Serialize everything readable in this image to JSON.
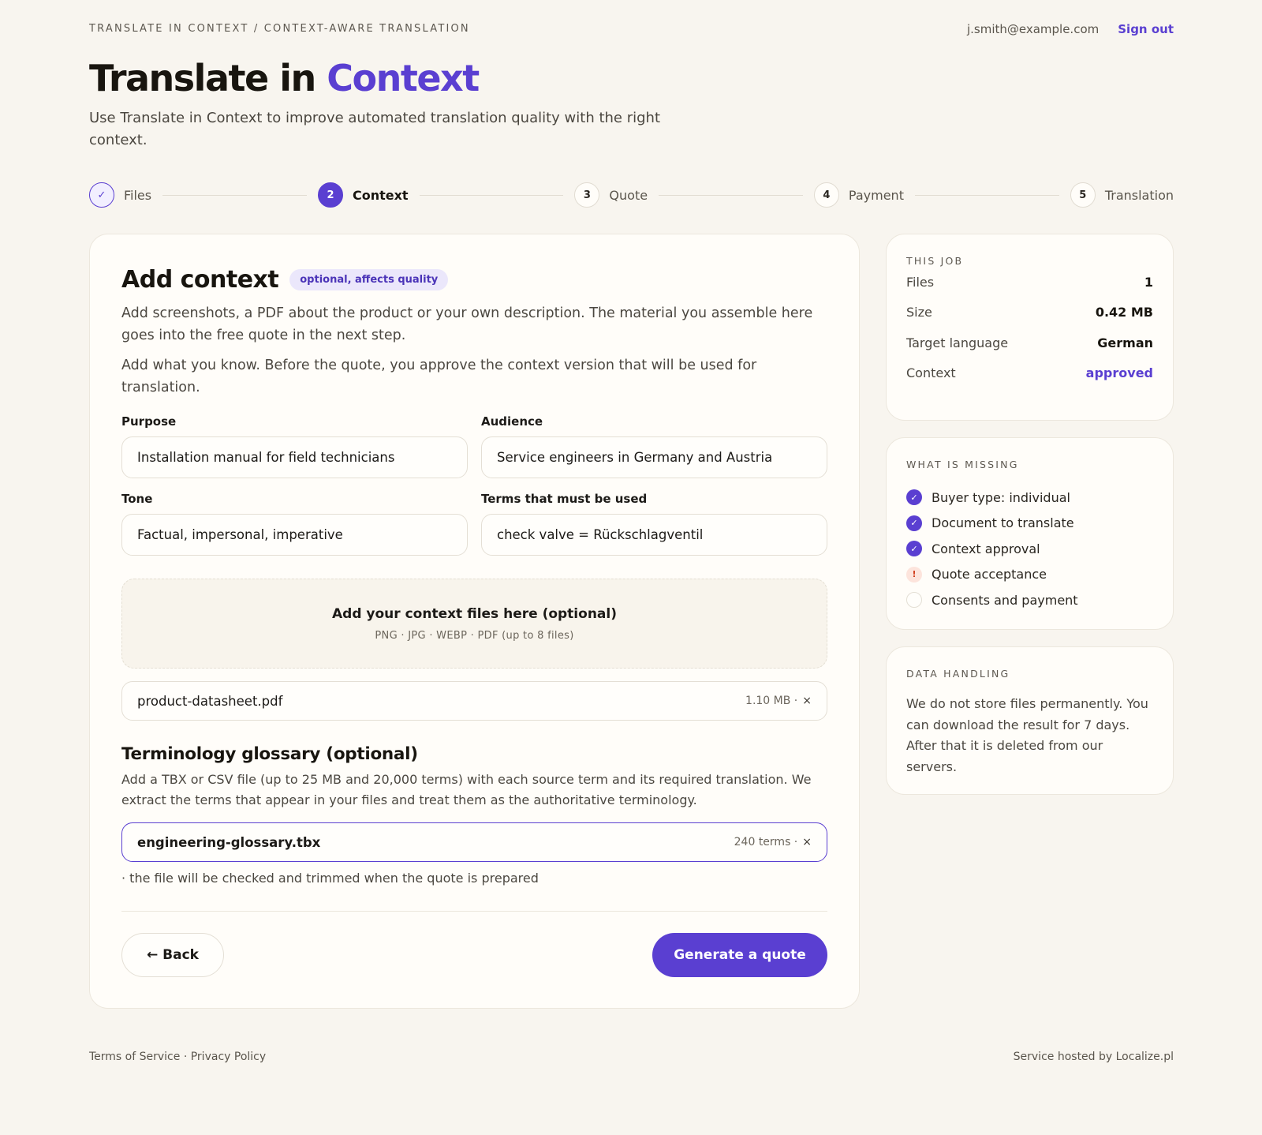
{
  "header": {
    "breadcrumb": "TRANSLATE IN CONTEXT / CONTEXT-AWARE TRANSLATION",
    "user_email": "j.smith@example.com",
    "sign_out": "Sign out",
    "title_main": "Translate in ",
    "title_accent": "Context",
    "subtitle": "Use Translate in Context to improve automated translation quality with the right context."
  },
  "stepper": {
    "steps": [
      {
        "number": "✓",
        "label": "Files",
        "state": "done"
      },
      {
        "number": "2",
        "label": "Context",
        "state": "active"
      },
      {
        "number": "3",
        "label": "Quote",
        "state": "pending"
      },
      {
        "number": "4",
        "label": "Payment",
        "state": "pending"
      },
      {
        "number": "5",
        "label": "Translation",
        "state": "pending"
      }
    ]
  },
  "context": {
    "heading": "Add context",
    "badge": "optional, affects quality",
    "desc1": "Add screenshots, a PDF about the product or your own description. The material you assemble here goes into the free quote in the next step.",
    "desc2": "Add what you know. Before the quote, you approve the context version that will be used for translation.",
    "fields": {
      "purpose": {
        "label": "Purpose",
        "value": "Installation manual for field technicians"
      },
      "audience": {
        "label": "Audience",
        "value": "Service engineers in Germany and Austria"
      },
      "tone": {
        "label": "Tone",
        "value": "Factual, impersonal, imperative"
      },
      "terms": {
        "label": "Terms that must be used",
        "value": "check valve = Rückschlagventil"
      }
    },
    "dropzone": {
      "title": "Add your context files here (optional)",
      "formats": "PNG · JPG · WEBP · PDF (up to 8 files)"
    },
    "uploaded_file": {
      "name": "product-datasheet.pdf",
      "meta": "1.10 MB ·",
      "remove": "×"
    }
  },
  "glossary": {
    "heading": "Terminology glossary (optional)",
    "desc": "Add a TBX or CSV file (up to 25 MB and 20,000 terms) with each source term and its required translation. We extract the terms that appear in your files and treat them as the authoritative terminology.",
    "file": {
      "name": "engineering-glossary.tbx",
      "meta": "240 terms ·",
      "remove": "×"
    },
    "note": "· the file will be checked and trimmed when the quote is prepared"
  },
  "actions": {
    "back": "← Back",
    "generate": "Generate a quote"
  },
  "job": {
    "title": "THIS JOB",
    "rows": [
      {
        "key": "Files",
        "value": "1"
      },
      {
        "key": "Size",
        "value": "0.42 MB"
      },
      {
        "key": "Target language",
        "value": "German"
      },
      {
        "key": "Context",
        "value": "approved"
      }
    ]
  },
  "missing": {
    "title": "WHAT IS MISSING",
    "items": [
      {
        "label": "Buyer type: individual",
        "status": "done",
        "icon": "✓"
      },
      {
        "label": "Document to translate",
        "status": "done",
        "icon": "✓"
      },
      {
        "label": "Context approval",
        "status": "done",
        "icon": "✓"
      },
      {
        "label": "Quote acceptance",
        "status": "warn",
        "icon": "!"
      },
      {
        "label": "Consents and payment",
        "status": "pending",
        "icon": ""
      }
    ]
  },
  "data_handling": {
    "title": "DATA HANDLING",
    "text": "We do not store files permanently. You can download the result for 7 days. After that it is deleted from our servers."
  },
  "footer": {
    "terms": "Terms of Service",
    "separator": " · ",
    "privacy": "Privacy Policy",
    "hosted": "Service hosted by Localize.pl"
  },
  "colors": {
    "accent": "#5a3fd1",
    "background": "#f8f5ef",
    "warn": "#d13c1c"
  }
}
